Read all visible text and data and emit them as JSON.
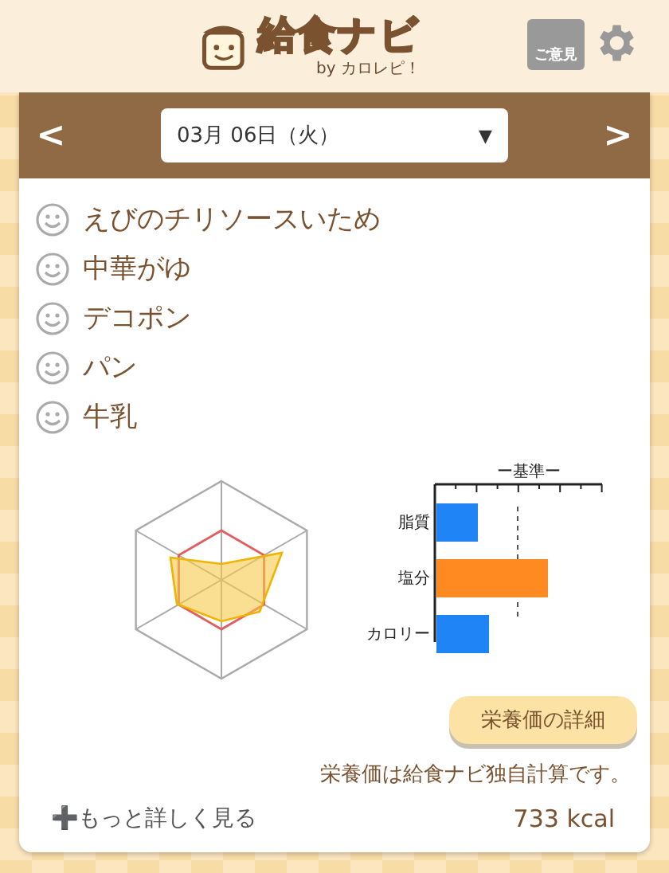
{
  "header": {
    "logo": "給食ナビ",
    "byline": "by カロレピ！",
    "opinion_label": "ご意見"
  },
  "date_bar": {
    "prev": "<",
    "date": "03月 06日（火）",
    "dropdown": "▼",
    "next": ">"
  },
  "menu": [
    {
      "name": "えびのチリソースいため"
    },
    {
      "name": "中華がゆ"
    },
    {
      "name": "デコポン"
    },
    {
      "name": "パン"
    },
    {
      "name": "牛乳"
    }
  ],
  "bar_chart": {
    "legend": "ー基準ー",
    "labels": [
      "脂質",
      "塩分",
      "カロリー"
    ]
  },
  "detail_button": "栄養価の詳細",
  "note": "栄養価は給食ナビ独自計算です。",
  "more_link": "➕もっと詳しく見る",
  "calories": "733 kcal"
}
